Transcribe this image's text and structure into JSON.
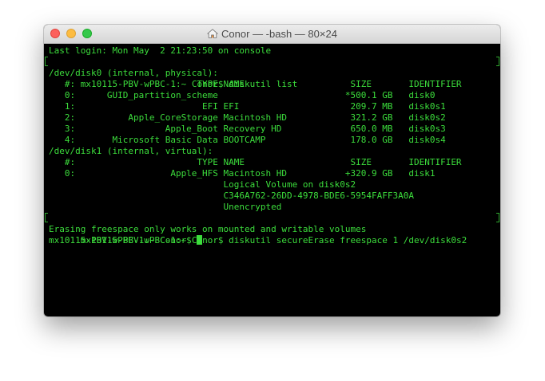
{
  "window": {
    "title": "Conor — -bash — 80×24",
    "title_icon": "home-icon",
    "controls": [
      "close",
      "minimize",
      "zoom"
    ]
  },
  "terminal": {
    "text_color": "#3cdd3c",
    "background_color": "#000000",
    "lines": [
      "Last login: Mon May  2 21:23:50 on console",
      "mx10115-PBV-wPBC-1:~ Conor$ diskutil list",
      "/dev/disk0 (internal, physical):",
      "   #:                       TYPE NAME                    SIZE       IDENTIFIER",
      "   0:      GUID_partition_scheme                        *500.1 GB   disk0",
      "   1:                        EFI EFI                     209.7 MB   disk0s1",
      "   2:          Apple_CoreStorage Macintosh HD            321.2 GB   disk0s2",
      "   3:                 Apple_Boot Recovery HD             650.0 MB   disk0s3",
      "   4:       Microsoft Basic Data BOOTCAMP                178.0 GB   disk0s4",
      "/dev/disk1 (internal, virtual):",
      "   #:                       TYPE NAME                    SIZE       IDENTIFIER",
      "   0:                  Apple_HFS Macintosh HD           +320.9 GB   disk1",
      "                                 Logical Volume on disk0s2",
      "                                 C346A762-26DD-4978-BDE6-5954FAFF3A0A",
      "                                 Unencrypted",
      "mx10115-PBV-wPBC-1:~ Conor$ diskutil secureErase freespace 1 /dev/disk0s2",
      "Erasing freespace only works on mounted and writable volumes",
      "mx10115-PBV-wPBC-1:~ Conor$ "
    ]
  }
}
